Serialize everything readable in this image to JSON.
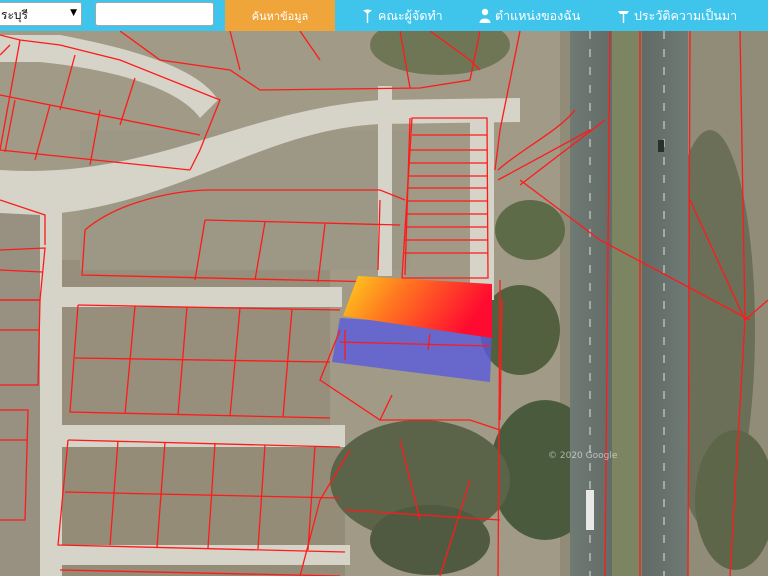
{
  "toolbar": {
    "province_value": "ระบุรี",
    "search_placeholder": "",
    "search_button": "ค้นหาข้อมูล",
    "nav_organizer": "คณะผู้จัดทำ",
    "nav_my_location": "ตำแหน่งของฉัน",
    "nav_history": "ประวัติความเป็นมา"
  },
  "map": {
    "watermark": "© 2020 Google",
    "parcel_line_color": "#ff1a1a",
    "highlight_gradient": [
      "#ffd21f",
      "#ff7a1f",
      "#ff0a30"
    ],
    "overlay_color": "#5a5adc"
  }
}
